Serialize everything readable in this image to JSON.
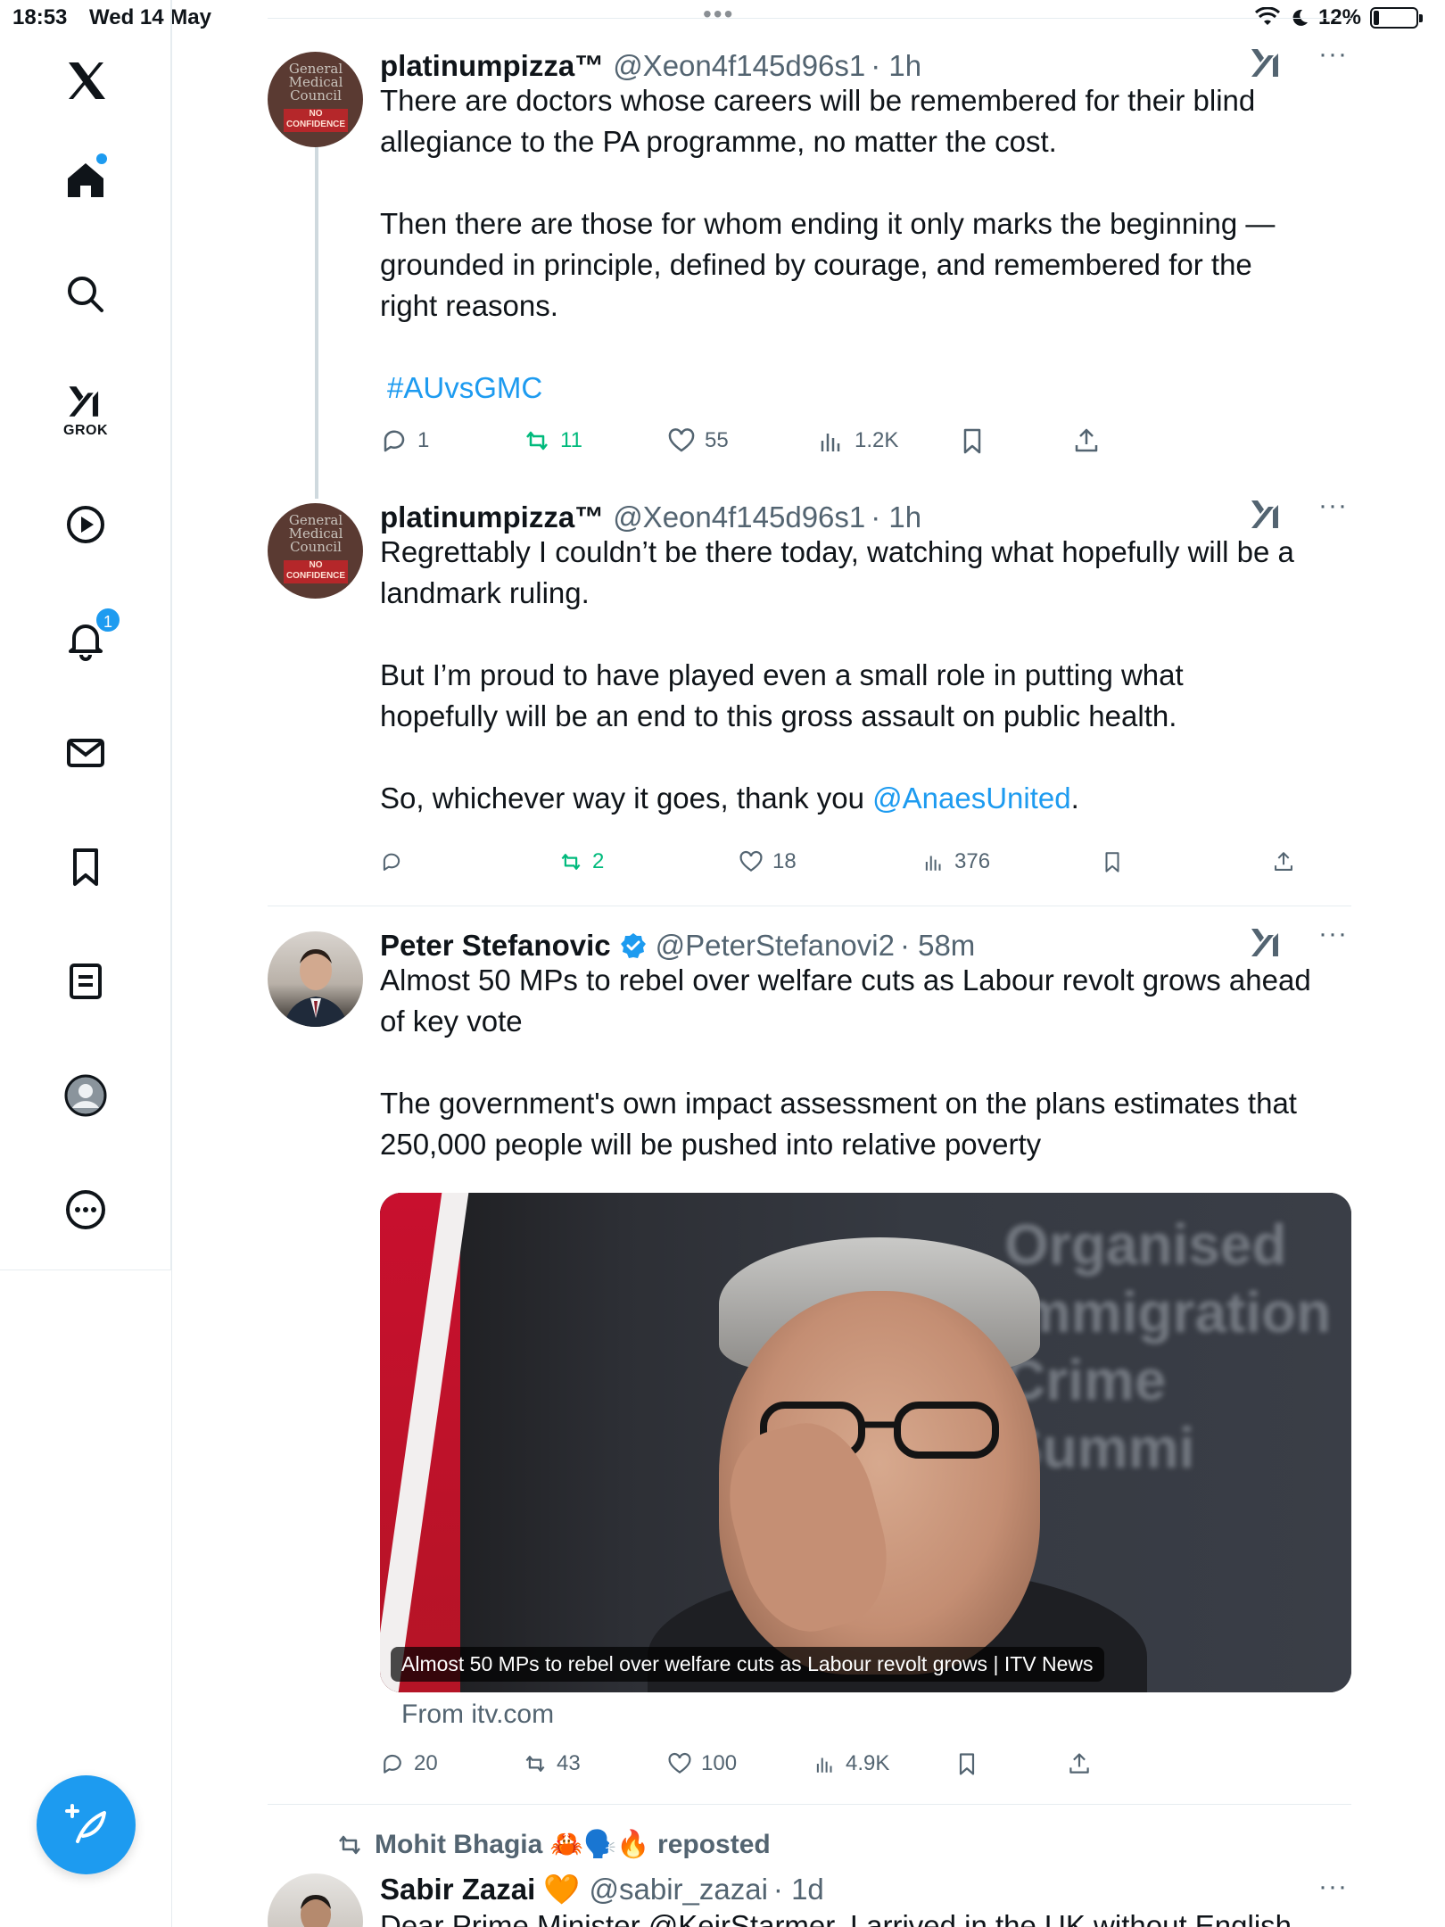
{
  "status": {
    "time": "18:53",
    "date": "Wed 14 May",
    "battery": "12%",
    "battery_level": 0.12
  },
  "sidebar": {
    "grok_label": "GROK",
    "notifications_count": "1"
  },
  "tweets": [
    {
      "name": "platinumpizza™",
      "handle": "@Xeon4f145d96s1",
      "time": "· 1h",
      "lines": [
        "There are doctors whose careers will be remembered for their blind",
        "allegiance to the PA programme, no matter the cost.",
        "",
        "Then there are those for whom ending it only marks the beginning —",
        "grounded in principle, defined by courage, and remembered for the",
        "right reasons.",
        "",
        "#AUvsGMC"
      ],
      "hashtag": "#AUvsGMC",
      "replies": "1",
      "reposts": "11",
      "likes": "55",
      "views": "1.2K"
    },
    {
      "name": "platinumpizza™",
      "handle": "@Xeon4f145d96s1",
      "time": "· 1h",
      "line1": "Regrettably I couldn’t be there today, watching what hopefully will be a",
      "line2": "landmark ruling.",
      "line3": "But I’m proud to have played even a small role in putting what",
      "line4": "hopefully will be an end to this gross assault on public health.",
      "line5_pre": "So, whichever way it goes, thank you ",
      "line5_link": "@AnaesUnited",
      "line5_post": ".",
      "replies": "",
      "reposts": "2",
      "likes": "18",
      "views": "376"
    },
    {
      "name": "Peter Stefanovic",
      "handle": "@PeterStefanovi2",
      "time": "· 58m",
      "line1": "Almost 50 MPs to rebel over welfare cuts as Labour revolt grows ahead",
      "line2": "of key vote",
      "line3": "The government's own impact assessment on the plans estimates that",
      "line4": "250,000 people will be pushed into relative poverty",
      "card_caption": "Almost 50 MPs to rebel over welfare cuts as Labour revolt grows | ITV News",
      "card_bg_text": "Organised Immigration Crime Summi",
      "from": "From itv.com",
      "replies": "20",
      "reposts": "43",
      "likes": "100",
      "views": "4.9K"
    },
    {
      "repost_by": "Mohit Bhagia 🦀🗣️🔥 reposted",
      "name": "Sabir Zazai 🧡",
      "handle": "@sabir_zazai",
      "time": "· 1d",
      "partial_text": "Dear Prime Minister @KeirStarmer, I arrived in the UK without English"
    }
  ],
  "colors": {
    "accent": "#1d9bf0",
    "repost_green": "#00ba7c",
    "muted": "#536471"
  }
}
